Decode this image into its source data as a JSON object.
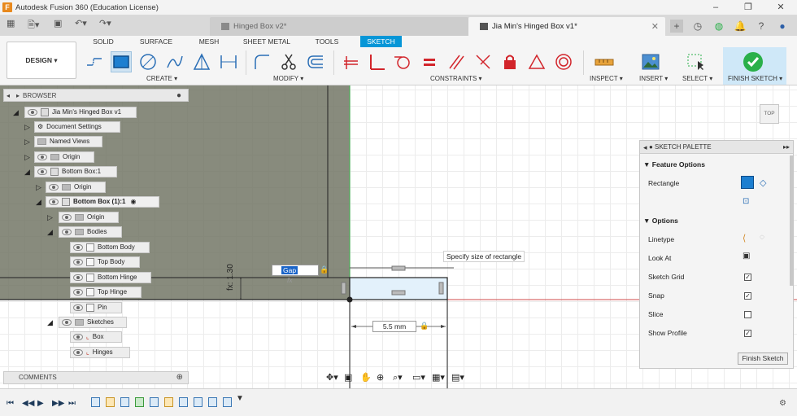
{
  "app": {
    "title": "Autodesk Fusion 360 (Education License)"
  },
  "tabs": [
    {
      "label": "Hinged Box v2*"
    },
    {
      "label": "Jia Min's Hinged Box v1*"
    }
  ],
  "workspace_tabs": [
    "SOLID",
    "SURFACE",
    "MESH",
    "SHEET METAL",
    "TOOLS",
    "SKETCH"
  ],
  "design_button": "DESIGN ▾",
  "groups": {
    "create": "CREATE ▾",
    "modify": "MODIFY ▾",
    "constraints": "CONSTRAINTS ▾",
    "inspect": "INSPECT ▾",
    "insert": "INSERT ▾",
    "select": "SELECT ▾",
    "finish": "FINISH SKETCH ▾"
  },
  "browser": {
    "header": "BROWSER",
    "nodes": [
      "Jia Min's Hinged Box v1",
      "Document Settings",
      "Named Views",
      "Origin",
      "Bottom Box:1",
      "Origin",
      "Bottom Box (1):1",
      "Origin",
      "Bodies",
      "Bottom Body",
      "Top Body",
      "Bottom Hinge",
      "Top Hinge",
      "Pin",
      "Sketches",
      "Box",
      "Hinges"
    ]
  },
  "comments": "COMMENTS",
  "canvas": {
    "tooltip": "Specify size of rectangle",
    "gap_input": "Gap",
    "fx": "fx",
    "dim_vertical": "fx: 1.30",
    "dim_horizontal": "5.5 mm",
    "viewcube": "TOP"
  },
  "palette": {
    "header": "SKETCH PALETTE",
    "feature_options": "Feature Options",
    "rectangle": "Rectangle",
    "options": "Options",
    "rows": [
      {
        "label": "Linetype",
        "checked": null
      },
      {
        "label": "Look At",
        "checked": null
      },
      {
        "label": "Sketch Grid",
        "checked": true
      },
      {
        "label": "Snap",
        "checked": true
      },
      {
        "label": "Slice",
        "checked": false
      },
      {
        "label": "Show Profile",
        "checked": true
      }
    ],
    "finish_button": "Finish Sketch"
  },
  "colors": {
    "accent": "#0696d7",
    "finish_green": "#2ab04a",
    "constraint_red": "#d2252b"
  }
}
